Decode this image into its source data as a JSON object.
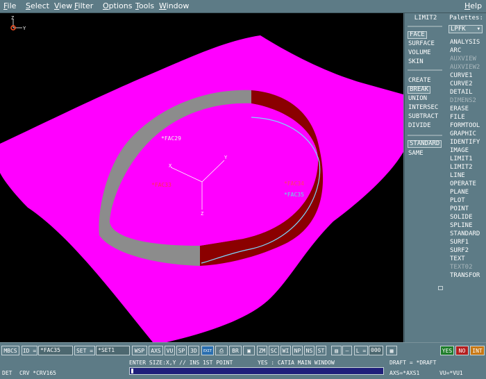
{
  "menubar": {
    "items": [
      "File",
      "Select",
      "View",
      "Filter",
      "Options",
      "Tools",
      "Window"
    ],
    "help": "Help"
  },
  "viewport": {
    "triad_top": "Z",
    "triad_right": "Y",
    "labels": {
      "fac29": "*FAC29",
      "fac33": "*FAC33",
      "fac34": "*FAC34",
      "fac35": "*FAC35",
      "axis_y": "Y",
      "axis_x": "X",
      "axis_z": "Z"
    }
  },
  "limit2": {
    "title": "LIMIT2",
    "group1": [
      "FACE",
      "SURFACE",
      "VOLUME",
      "SKIN"
    ],
    "group2": [
      "CREATE",
      "BREAK",
      "UNION",
      "INTERSEC",
      "SUBTRACT",
      "DIVIDE"
    ],
    "group3": [
      "STANDARD",
      "SAME"
    ]
  },
  "palettes": {
    "title": "Palettes:",
    "dropdown": "LPFK",
    "items": [
      "ANALYSIS",
      "ARC",
      "AUXVIEW",
      "AUXVIEW2",
      "CURVE1",
      "CURVE2",
      "DETAIL",
      "DIMENS2",
      "ERASE",
      "FILE",
      "FORMTOOL",
      "GRAPHIC",
      "IDENTIFY",
      "IMAGE",
      "LIMIT1",
      "LIMIT2",
      "LINE",
      "OPERATE",
      "PLANE",
      "PLOT",
      "POINT",
      "SOLIDE",
      "SPLINE",
      "STANDARD",
      "SURF1",
      "SURF2",
      "TEXT",
      "TEXT02",
      "TRANSFOR"
    ]
  },
  "toolbar": {
    "mbcs": "MBCS",
    "id_label": "ID",
    "id_value": "*FAC35",
    "set_label": "SET",
    "set_value": "*SET1",
    "buttons1": [
      "WSP",
      "AXS",
      "VU",
      "SP",
      "3D"
    ],
    "exit": "EXIT",
    "br": "BR",
    "buttons2": [
      "ZM",
      "SC",
      "WI",
      "NP",
      "NS",
      "ST"
    ],
    "l_label": "L",
    "l_value": "000",
    "yes": "YES",
    "no": "NO",
    "int": "INT"
  },
  "status": {
    "prompt": "ENTER SIZE:X,Y // INS 1ST POINT",
    "window": "YES : CATIA MAIN WINDOW",
    "draft": "DRAFT = *DRAFT",
    "mode": "DET",
    "crv": "CRV  *CRV165",
    "axs": "AXS=*AXS1",
    "vu": "VU=*VU1",
    "progress": 0.01
  }
}
